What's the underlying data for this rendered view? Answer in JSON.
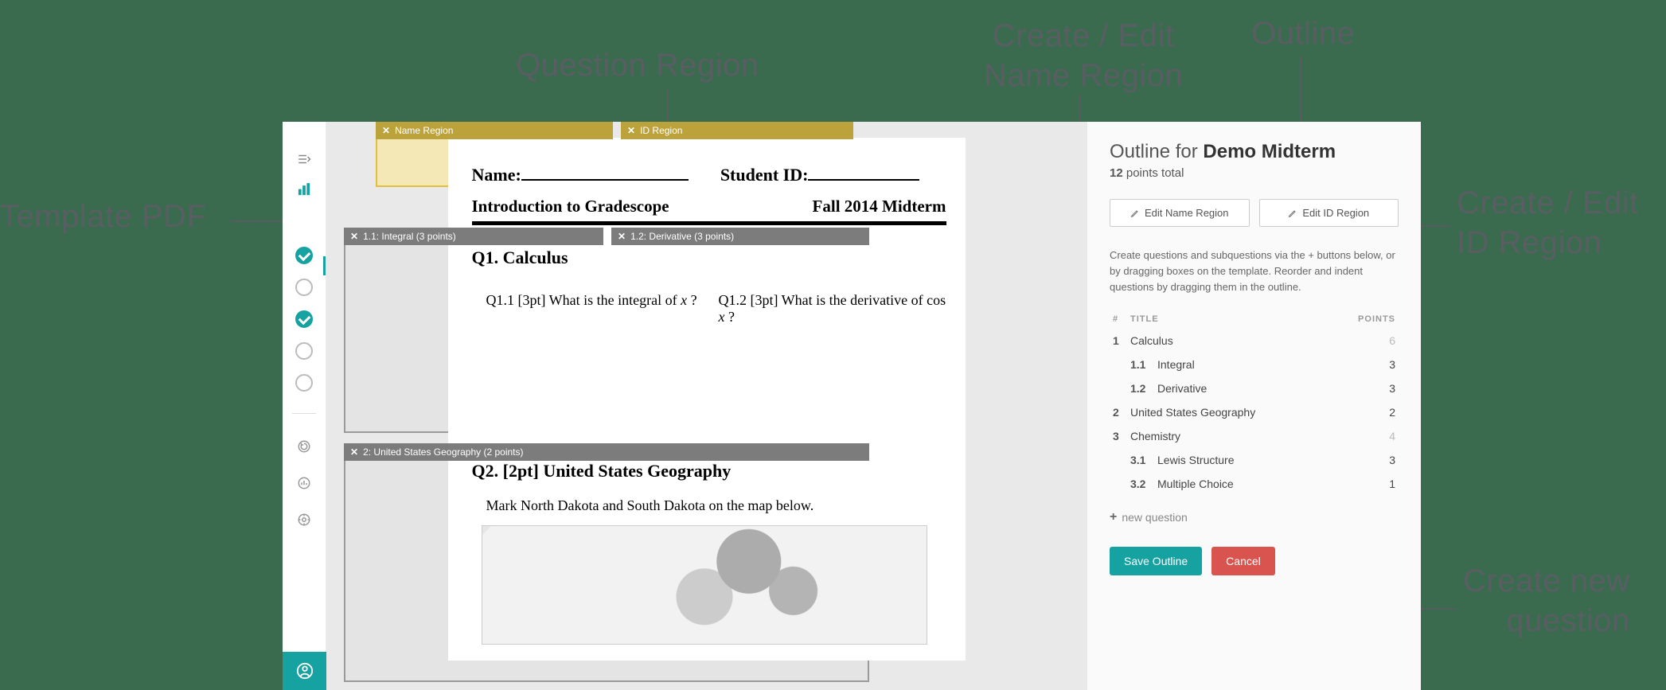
{
  "callouts": {
    "template_pdf": "Template PDF",
    "question_region": "Question Region",
    "name_region": "Create / Edit\nName Region",
    "outline": "Outline",
    "id_region": "Create / Edit\nID Region",
    "new_question": "Create new\nquestion"
  },
  "sidebar": {
    "steps": [
      {
        "done": true
      },
      {
        "done": false
      },
      {
        "done": true
      },
      {
        "done": false
      },
      {
        "done": false
      }
    ]
  },
  "pdf": {
    "name_region_tab": "Name Region",
    "id_region_tab": "ID Region",
    "name_label": "Name:",
    "id_label": "Student ID:",
    "course_title": "Introduction to Gradescope",
    "term": "Fall 2014 Midterm",
    "q1_tab": "1.1: Integral (3 points)",
    "q12_tab": "1.2: Derivative (3 points)",
    "q1_head": "Q1.  Calculus",
    "q11_text_a": "Q1.1  [3pt] What is the integral of ",
    "q11_text_var": "x",
    "q11_text_b": " ?",
    "q12_text_a": "Q1.2  [3pt]  What is the derivative of  cos ",
    "q12_text_var": "x",
    "q12_text_b": " ?",
    "q2_tab": "2: United States Geography (2 points)",
    "q2_head": "Q2.  [2pt] United States Geography",
    "q2_text": "Mark North Dakota and South Dakota on the map below."
  },
  "outline": {
    "prefix": "Outline for ",
    "assignment": "Demo Midterm",
    "points_total": "12",
    "points_total_label": " points total",
    "edit_name_btn": "Edit Name Region",
    "edit_id_btn": "Edit ID Region",
    "help": "Create questions and subquestions via the + buttons below, or by dragging boxes on the template. Reorder and indent questions by dragging them in the outline.",
    "col_num": "#",
    "col_title": "TITLE",
    "col_points": "POINTS",
    "rows": [
      {
        "num": "1",
        "title": "Calculus",
        "points": "6",
        "parent": true
      },
      {
        "num": "1.1",
        "title": "Integral",
        "points": "3",
        "sub": true
      },
      {
        "num": "1.2",
        "title": "Derivative",
        "points": "3",
        "sub": true
      },
      {
        "num": "2",
        "title": "United States Geography",
        "points": "2",
        "parent": false
      },
      {
        "num": "3",
        "title": "Chemistry",
        "points": "4",
        "parent": true
      },
      {
        "num": "3.1",
        "title": "Lewis Structure",
        "points": "3",
        "sub": true
      },
      {
        "num": "3.2",
        "title": "Multiple Choice",
        "points": "1",
        "sub": true
      }
    ],
    "new_question": "new question",
    "save": "Save Outline",
    "cancel": "Cancel"
  }
}
